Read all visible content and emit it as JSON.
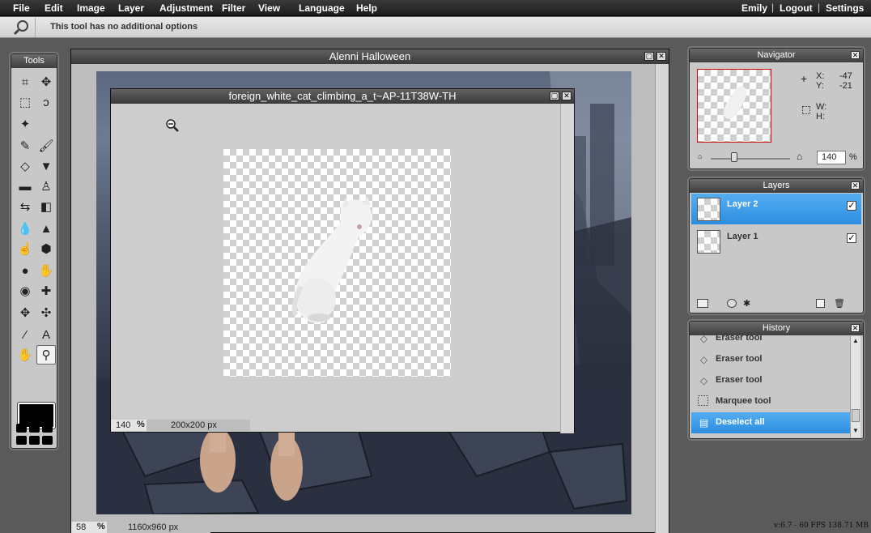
{
  "menu": {
    "items": [
      "File",
      "Edit",
      "Image",
      "Layer",
      "Adjustment",
      "Filter",
      "View",
      "Language",
      "Help"
    ],
    "user": "Emily",
    "logout": "Logout",
    "settings": "Settings",
    "separator": "|"
  },
  "options_bar": {
    "tool_icon": "magnifier-icon",
    "message": "This tool has no additional options"
  },
  "tools_panel": {
    "title": "Tools",
    "tools": [
      "crop",
      "move",
      "marquee",
      "lasso",
      "magic-wand",
      "pencil",
      "brush",
      "eraser",
      "bucket",
      "gradient",
      "clone-stamp",
      "color-replace",
      "shape",
      "blur",
      "sharpen",
      "smudge",
      "sponge",
      "dodge",
      "burn",
      "red-eye",
      "spot-heal",
      "bloat",
      "pinch",
      "color-picker",
      "text",
      "hand",
      "zoom"
    ],
    "active_tool": "zoom",
    "foreground_color": "#000000"
  },
  "main_window": {
    "title": "Alenni Halloween",
    "zoom_value": "58",
    "zoom_unit": "%",
    "size": "1160x960 px"
  },
  "float_window": {
    "title": "foreign_white_cat_climbing_a_t~AP-11T38W-TH",
    "zoom_value": "140",
    "zoom_unit": "%",
    "size": "200x200 px"
  },
  "navigator": {
    "title": "Navigator",
    "x_label": "X:",
    "x_value": "-47",
    "y_label": "Y:",
    "y_value": "-21",
    "w_label": "W:",
    "h_label": "H:",
    "zoom_value": "140",
    "zoom_unit": "%",
    "zoom_slider_fraction": 0.3
  },
  "layers": {
    "title": "Layers",
    "items": [
      {
        "name": "Layer 2",
        "selected": true,
        "visible": true
      },
      {
        "name": "Layer 1",
        "selected": false,
        "visible": true
      }
    ]
  },
  "history": {
    "title": "History",
    "items": [
      {
        "label": "Eraser tool",
        "icon": "eraser-icon"
      },
      {
        "label": "Eraser tool",
        "icon": "eraser-icon"
      },
      {
        "label": "Eraser tool",
        "icon": "eraser-icon"
      },
      {
        "label": "Marquee tool",
        "icon": "marquee-icon"
      },
      {
        "label": "Deselect all",
        "icon": "deselect-icon"
      }
    ],
    "selected_index": 4
  },
  "footer": {
    "version": "v:6.7 - 60 FPS 138.71 MB"
  },
  "colors": {
    "selection_blue": "#3f9be8",
    "title_dark": "#3e3e3e",
    "panel_gray": "#c8c8c8"
  }
}
